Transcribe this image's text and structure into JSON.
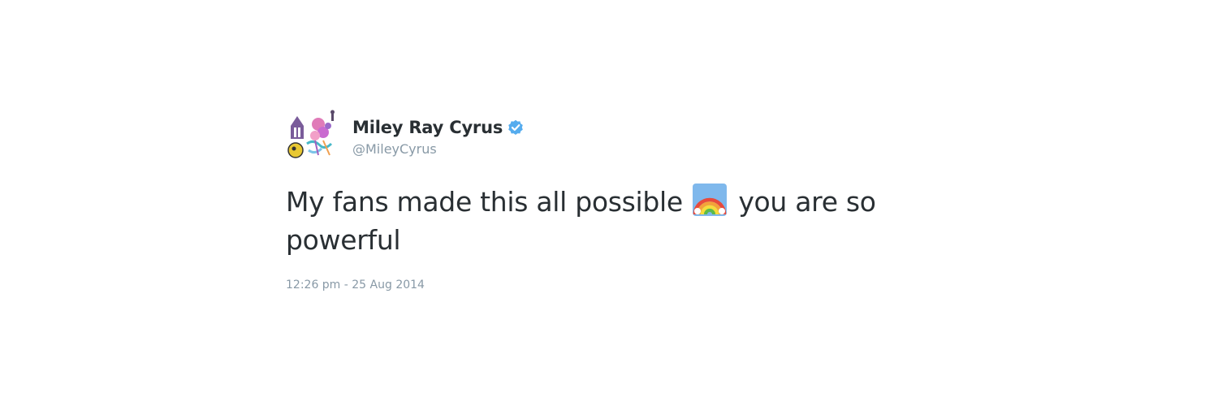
{
  "tweet": {
    "author": {
      "display_name": "Miley Ray Cyrus",
      "handle": "@MileyCyrus",
      "verified": true,
      "avatar_icon": "colorful-drawing-avatar",
      "verified_icon": "verified-badge-icon"
    },
    "text_part1": "My fans made this all possible",
    "emoji": "rainbow-emoji",
    "text_part2": "you are so powerful",
    "timestamp": "12:26 pm - 25 Aug 2014"
  },
  "colors": {
    "text": "#292f33",
    "muted": "#8899a6",
    "verified": "#55acee",
    "background": "#ffffff"
  }
}
